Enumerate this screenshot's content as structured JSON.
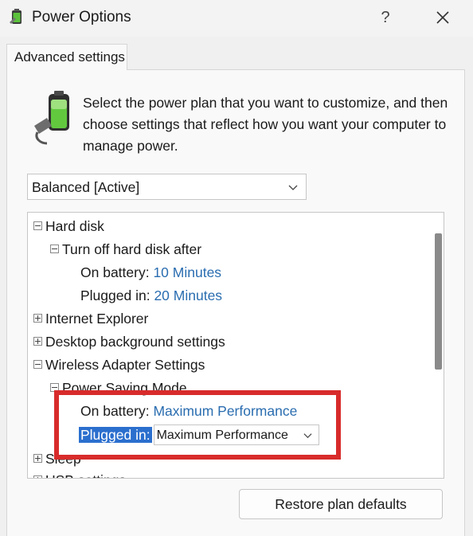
{
  "window": {
    "title": "Power Options",
    "help_label": "?",
    "app_icon": "power-options-icon",
    "close_icon": "close-icon"
  },
  "tab": {
    "label": "Advanced settings"
  },
  "description": "Select the power plan that you want to customize, and then choose settings that reflect how you want your computer to manage power.",
  "plan_select": {
    "value": "Balanced [Active]"
  },
  "tree": {
    "hard_disk": "Hard disk",
    "turn_off_hard_disk": "Turn off hard disk after",
    "hd_on_battery_label": "On battery:",
    "hd_on_battery_value": "10 Minutes",
    "hd_plugged_label": "Plugged in:",
    "hd_plugged_value": "20 Minutes",
    "internet_explorer": "Internet Explorer",
    "desktop_background": "Desktop background settings",
    "wireless_adapter": "Wireless Adapter Settings",
    "power_saving_mode": "Power Saving Mode",
    "ws_on_battery_label": "On battery:",
    "ws_on_battery_value": "Maximum Performance",
    "ws_plugged_label": "Plugged in:",
    "ws_plugged_value": "Maximum Performance",
    "sleep": "Sleep",
    "usb_settings": "USB settings"
  },
  "buttons": {
    "restore": "Restore plan defaults"
  },
  "colors": {
    "link": "#2a6db0",
    "selection": "#2b6fce",
    "highlight_border": "#d82b2b"
  }
}
